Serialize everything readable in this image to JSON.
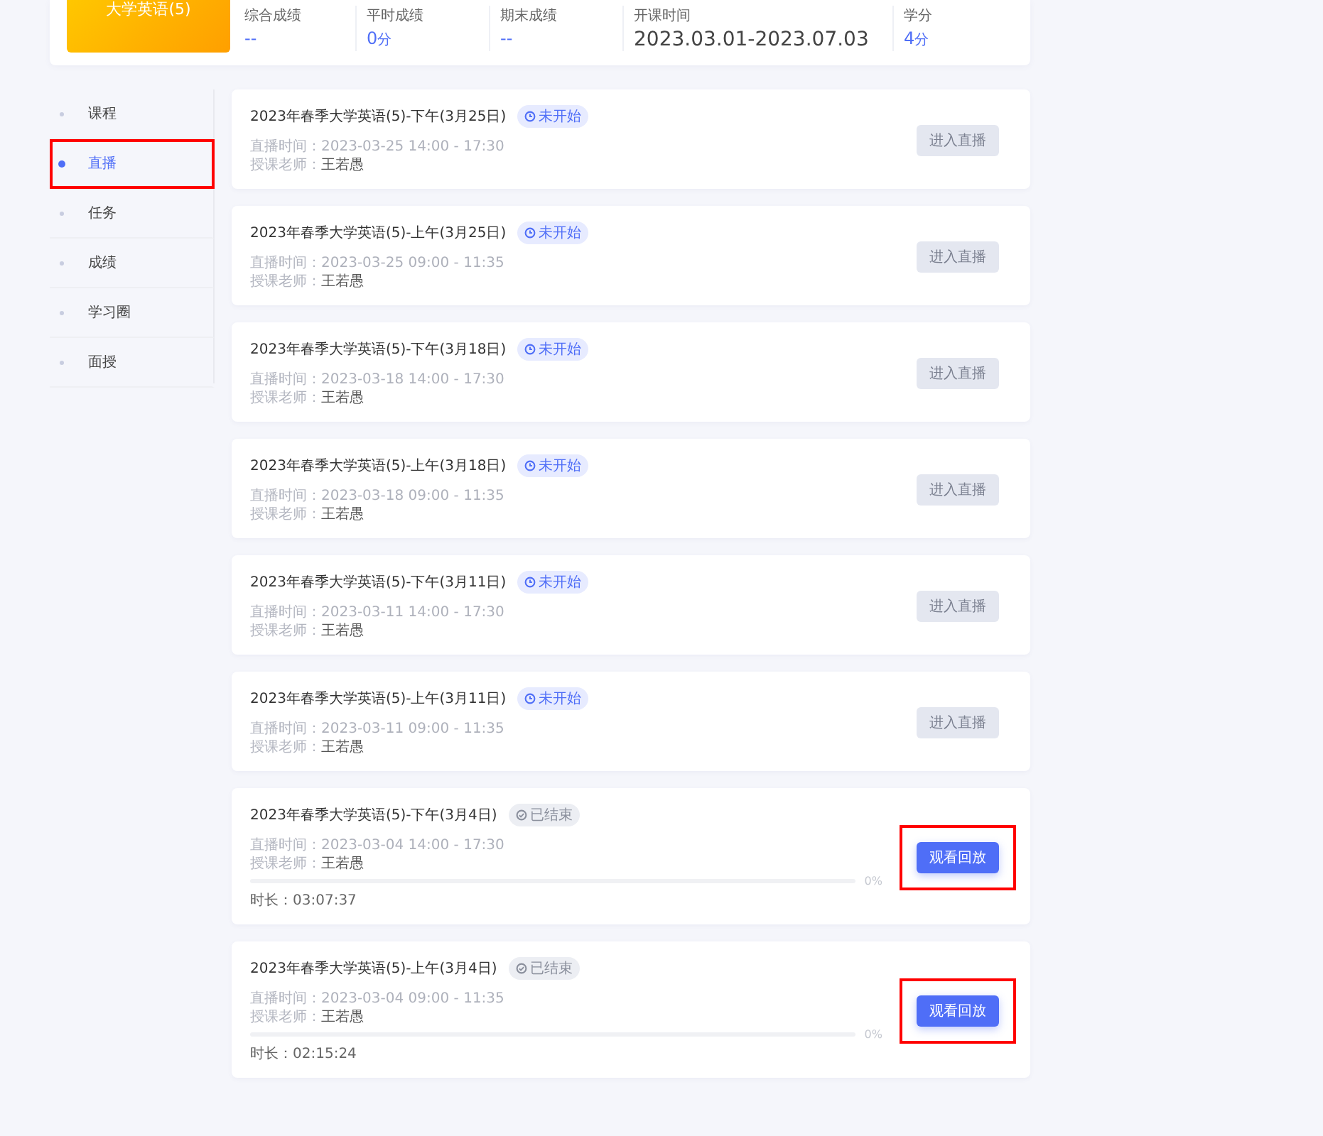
{
  "course": {
    "thumbnail_title": "大学英语(5)",
    "stats": [
      {
        "label": "综合成绩",
        "value": "--",
        "kind": "score"
      },
      {
        "label": "平时成绩",
        "value": "0",
        "unit": "分",
        "kind": "score"
      },
      {
        "label": "期末成绩",
        "value": "--",
        "kind": "score"
      },
      {
        "label": "开课时间",
        "value": "2023.03.01-2023.07.03",
        "kind": "date"
      },
      {
        "label": "学分",
        "value": "4",
        "unit": "分",
        "kind": "score"
      }
    ]
  },
  "sidebar": {
    "items": [
      {
        "label": "课程",
        "selected": false,
        "highlighted": false
      },
      {
        "label": "直播",
        "selected": true,
        "highlighted": true
      },
      {
        "label": "任务",
        "selected": false,
        "highlighted": false
      },
      {
        "label": "成绩",
        "selected": false,
        "highlighted": false
      },
      {
        "label": "学习圈",
        "selected": false,
        "highlighted": false
      },
      {
        "label": "面授",
        "selected": false,
        "highlighted": false
      }
    ]
  },
  "sessions": [
    {
      "title": "2023年春季大学英语(5)-下午(3月25日)",
      "status": {
        "kind": "upcoming",
        "label": "未开始"
      },
      "time_label": "直播时间：",
      "time": "2023-03-25 14:00 - 17:30",
      "teacher_label": "授课老师：",
      "teacher": "王若愚",
      "button": {
        "label": "进入直播",
        "disabled": true
      },
      "highlighted": false
    },
    {
      "title": "2023年春季大学英语(5)-上午(3月25日)",
      "status": {
        "kind": "upcoming",
        "label": "未开始"
      },
      "time_label": "直播时间：",
      "time": "2023-03-25 09:00 - 11:35",
      "teacher_label": "授课老师：",
      "teacher": "王若愚",
      "button": {
        "label": "进入直播",
        "disabled": true
      },
      "highlighted": false
    },
    {
      "title": "2023年春季大学英语(5)-下午(3月18日)",
      "status": {
        "kind": "upcoming",
        "label": "未开始"
      },
      "time_label": "直播时间：",
      "time": "2023-03-18 14:00 - 17:30",
      "teacher_label": "授课老师：",
      "teacher": "王若愚",
      "button": {
        "label": "进入直播",
        "disabled": true
      },
      "highlighted": false
    },
    {
      "title": "2023年春季大学英语(5)-上午(3月18日)",
      "status": {
        "kind": "upcoming",
        "label": "未开始"
      },
      "time_label": "直播时间：",
      "time": "2023-03-18 09:00 - 11:35",
      "teacher_label": "授课老师：",
      "teacher": "王若愚",
      "button": {
        "label": "进入直播",
        "disabled": true
      },
      "highlighted": false
    },
    {
      "title": "2023年春季大学英语(5)-下午(3月11日)",
      "status": {
        "kind": "upcoming",
        "label": "未开始"
      },
      "time_label": "直播时间：",
      "time": "2023-03-11 14:00 - 17:30",
      "teacher_label": "授课老师：",
      "teacher": "王若愚",
      "button": {
        "label": "进入直播",
        "disabled": true
      },
      "highlighted": false
    },
    {
      "title": "2023年春季大学英语(5)-上午(3月11日)",
      "status": {
        "kind": "upcoming",
        "label": "未开始"
      },
      "time_label": "直播时间：",
      "time": "2023-03-11 09:00 - 11:35",
      "teacher_label": "授课老师：",
      "teacher": "王若愚",
      "button": {
        "label": "进入直播",
        "disabled": true
      },
      "highlighted": false
    },
    {
      "title": "2023年春季大学英语(5)-下午(3月4日)",
      "status": {
        "kind": "ended",
        "label": "已结束"
      },
      "time_label": "直播时间：",
      "time": "2023-03-04 14:00 - 17:30",
      "teacher_label": "授课老师：",
      "teacher": "王若愚",
      "progress": {
        "level": 0,
        "reading": "0%"
      },
      "duration": "时长：03:07:37",
      "button": {
        "label": "观看回放",
        "disabled": false
      },
      "highlighted": true
    },
    {
      "title": "2023年春季大学英语(5)-上午(3月4日)",
      "status": {
        "kind": "ended",
        "label": "已结束"
      },
      "time_label": "直播时间：",
      "time": "2023-03-04 09:00 - 11:35",
      "teacher_label": "授课老师：",
      "teacher": "王若愚",
      "progress": {
        "level": 0,
        "reading": "0%"
      },
      "duration": "时长：02:15:24",
      "button": {
        "label": "观看回放",
        "disabled": false
      },
      "highlighted": true
    }
  ]
}
